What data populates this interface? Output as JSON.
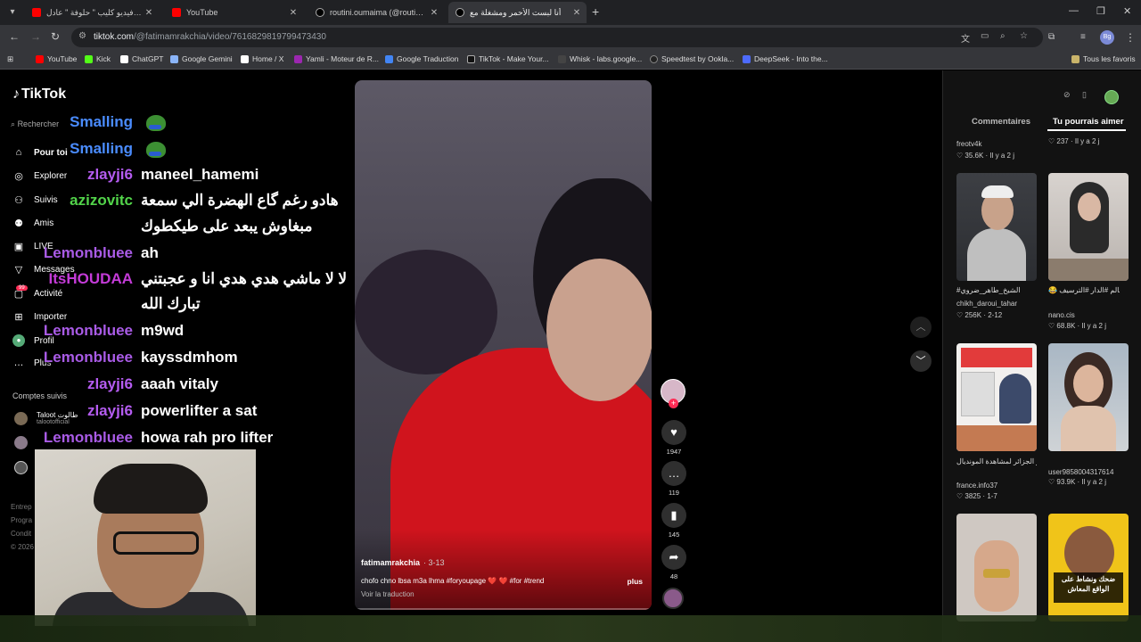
{
  "browser": {
    "tabs": [
      {
        "label": "حصري..فيديو كليب \" حلوفة \" عادل",
        "favicon": "yt"
      },
      {
        "label": "YouTube",
        "favicon": "yt"
      },
      {
        "label": "routini.oumaima (@routini.oum",
        "favicon": "tt"
      },
      {
        "label": "أنا لبست الأحمر ومشغلة مع",
        "favicon": "tt"
      }
    ],
    "url_host": "tiktok.com",
    "url_path": "/@fatimamrakchia/video/7616829819799473430",
    "profile_initials": "Bg",
    "bookmarks": [
      {
        "label": "YouTube",
        "color": "#ff0000"
      },
      {
        "label": "Kick",
        "color": "#53fc18"
      },
      {
        "label": "ChatGPT",
        "color": "#ffffff"
      },
      {
        "label": "Google Gemini",
        "color": "#8ab4f8"
      },
      {
        "label": "Home / X",
        "color": "#ffffff"
      },
      {
        "label": "Yamli - Moteur de R...",
        "color": "#9c27b0"
      },
      {
        "label": "Google Traduction",
        "color": "#4285f4"
      },
      {
        "label": "TikTok - Make Your...",
        "color": "#000000"
      },
      {
        "label": "Whisk - labs.google...",
        "color": "#444444"
      },
      {
        "label": "Speedtest by Ookla...",
        "color": "#222222"
      },
      {
        "label": "DeepSeek - Into the...",
        "color": "#4d6bfe"
      }
    ],
    "all_bookmarks": "Tous les favoris"
  },
  "tiktok": {
    "logo": "TikTok",
    "search_placeholder": "Rechercher",
    "nav": [
      {
        "label": "Pour toi",
        "icon": "home-icon"
      },
      {
        "label": "Explorer",
        "icon": "compass-icon"
      },
      {
        "label": "Suivis",
        "icon": "following-icon"
      },
      {
        "label": "Amis",
        "icon": "friends-icon"
      },
      {
        "label": "LIVE",
        "icon": "live-icon"
      },
      {
        "label": "Messages",
        "icon": "messages-icon"
      },
      {
        "label": "Activité",
        "icon": "activity-icon"
      },
      {
        "label": "Importer",
        "icon": "upload-icon"
      },
      {
        "label": "Profil",
        "icon": "profile-icon"
      },
      {
        "label": "Plus",
        "icon": "more-icon"
      }
    ],
    "activity_badge": "99",
    "followed_title": "Comptes suivis",
    "followed": [
      {
        "name": "Taloot طالوت",
        "handle": "talootofficial"
      }
    ],
    "footer": [
      "Entrep",
      "Progra",
      "Condit",
      "© 2026"
    ]
  },
  "chat": [
    {
      "user": "Smalling",
      "msg": "",
      "color": "#4a8cff",
      "emote": true
    },
    {
      "user": "Smalling",
      "msg": "",
      "color": "#4a8cff",
      "emote": true
    },
    {
      "user": "zlayji6",
      "msg": "maneel_hamemi",
      "color": "#b45cf0"
    },
    {
      "user": "azizovitc",
      "msg": "هادو رغم گاع الهضرة الي سمعة",
      "color": "#52d44a"
    },
    {
      "user": "",
      "msg": "مبغاوش يبعد على طيكطوك",
      "color": "#ffffff"
    },
    {
      "user": "Lemonbluee",
      "msg": "ah",
      "color": "#a95be6"
    },
    {
      "user": "ItsHOUDAA",
      "msg": "لا لا ماشي هدي هدي انا و عجبتني",
      "color": "#c43bd8"
    },
    {
      "user": "",
      "msg": "تبارك الله",
      "color": "#ffffff"
    },
    {
      "user": "Lemonbluee",
      "msg": "m9wd",
      "color": "#a95be6"
    },
    {
      "user": "Lemonbluee",
      "msg": "kayssdmhom",
      "color": "#a95be6"
    },
    {
      "user": "zlayji6",
      "msg": "aaah vitaly",
      "color": "#b45cf0"
    },
    {
      "user": "zlayji6",
      "msg": "powerlifter a sat",
      "color": "#b45cf0"
    },
    {
      "user": "Lemonbluee",
      "msg": "howa rah pro lifter",
      "color": "#a95be6"
    }
  ],
  "video": {
    "author": "fatimamrakchia",
    "date": "· 3-13",
    "description": "chofo chno lbsa m3a lhma #foryoupage ❤️ ❤️ #for #trend",
    "more": "plus",
    "translate": "Voir la traduction",
    "likes": "1947",
    "comments": "119",
    "saves": "145",
    "shares": "48"
  },
  "right_panel": {
    "tab_comments": "Commentaires",
    "tab_suggestions": "Tu pourrais aimer",
    "top_items": [
      {
        "author": "freotv4k",
        "stats": "35.6K · Il y a 2 j"
      },
      {
        "author": "",
        "stats": "237 · Il y a 2 j"
      }
    ],
    "videos": [
      {
        "title": "#الشيخ_طاهر_ضروي",
        "author": "chikh_daroui_tahar",
        "stats": "256K · 2-12"
      },
      {
        "title": "😂 نسيب تحدي بالعالم #الدار #الترسيف",
        "author": "nano.cis",
        "stats": "68.8K · Il y a 2 j"
      },
      {
        "title": "الترامب يمنع دخول جماهير الجزائر لمشاهدة المونديال",
        "author": "france.info37",
        "stats": "3825 · 1-7"
      },
      {
        "title": "",
        "author": "user9858004317614",
        "stats": "93.9K · Il y a 2 j"
      }
    ],
    "thumb_caption": "ضحك ونشاط على الواقع المعاش"
  }
}
